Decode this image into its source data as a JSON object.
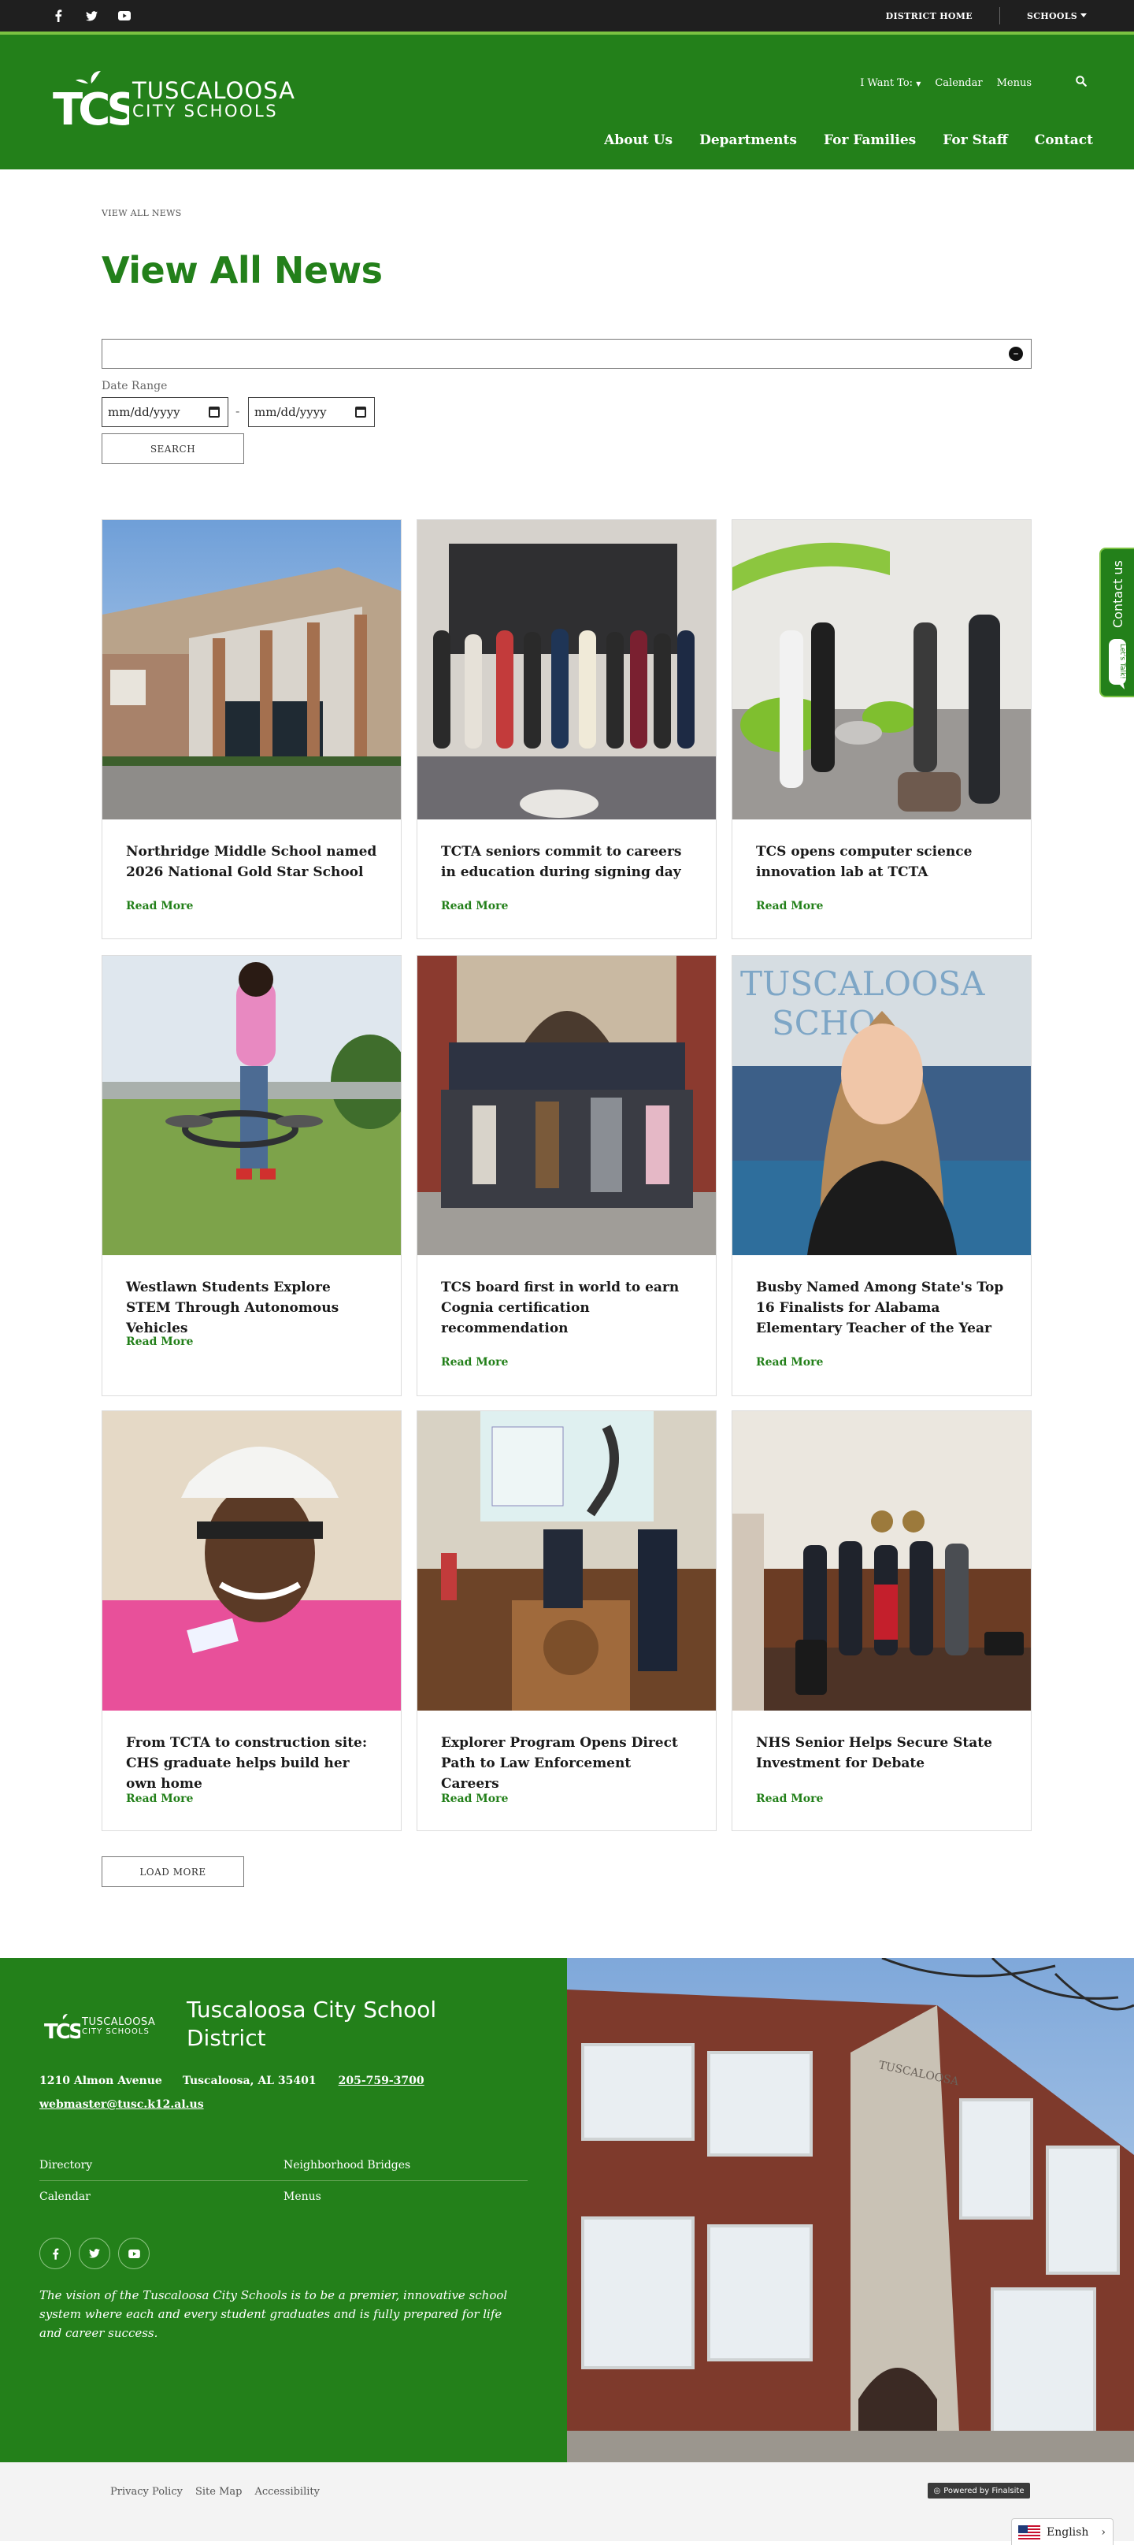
{
  "utility": {
    "social_icons": [
      "facebook-icon",
      "twitter-icon",
      "youtube-icon"
    ],
    "district_home": "DISTRICT HOME",
    "schools": "SCHOOLS"
  },
  "header": {
    "logo_line1": "TUSCALOOSA",
    "logo_line2": "CITY SCHOOLS",
    "logo_mark": "TCS",
    "top_menu": {
      "i_want_to": "I Want To:",
      "calendar": "Calendar",
      "menus": "Menus"
    },
    "nav": [
      "About Us",
      "Departments",
      "For Families",
      "For Staff",
      "Contact"
    ]
  },
  "breadcrumb": "VIEW ALL NEWS",
  "page_title": "View All News",
  "filters": {
    "keyword_value": "",
    "date_label": "Date Range",
    "start_placeholder": "mm/dd/yyyy",
    "end_placeholder": "mm/dd/yyyy",
    "dash": "-",
    "search_label": "SEARCH"
  },
  "news": [
    {
      "title": "Northridge Middle School named 2026 National Gold Star School",
      "more": "Read More"
    },
    {
      "title": "TCTA seniors commit to careers in education during signing day",
      "more": "Read More"
    },
    {
      "title": "TCS opens computer science innovation lab at TCTA",
      "more": "Read More"
    },
    {
      "title": "Westlawn Students Explore STEM Through Autonomous Vehicles",
      "more": "Read More"
    },
    {
      "title": "TCS board first in world to earn Cognia certification recommendation",
      "more": "Read More"
    },
    {
      "title": "Busby Named Among State's Top 16 Finalists for Alabama Elementary Teacher of the Year",
      "more": "Read More"
    },
    {
      "title": "From TCTA to construction site: CHS graduate helps build her own home",
      "more": "Read More"
    },
    {
      "title": "Explorer Program Opens Direct Path to Law Enforcement Careers",
      "more": "Read More"
    },
    {
      "title": "NHS Senior Helps Secure State Investment for Debate",
      "more": "Read More"
    }
  ],
  "load_more": "LOAD MORE",
  "contact_tab": {
    "label": "Contact us",
    "bubble_text": "Let's Talk!"
  },
  "footer": {
    "logo_line1": "TUSCALOOSA",
    "logo_line2": "CITY SCHOOLS",
    "district_name": "Tuscaloosa City School District",
    "address": "1210 Almon Avenue",
    "city": "Tuscaloosa, AL  35401",
    "phone": "205-759-3700",
    "email": "webmaster@tusc.k12.al.us",
    "links": [
      "Directory",
      "Neighborhood Bridges",
      "Calendar",
      "Menus"
    ],
    "vision": "The vision of the Tuscaloosa City Schools is to be a premier, innovative school system where each and every student graduates and is fully prepared for life and career success."
  },
  "bottom": {
    "links": [
      "Privacy Policy",
      "Site Map",
      "Accessibility"
    ],
    "powered": "Powered by Finalsite",
    "language": "English"
  },
  "colors": {
    "brand_green": "#23801a",
    "accent_green": "#7bc242",
    "dark_bar": "#1f1f1f"
  }
}
